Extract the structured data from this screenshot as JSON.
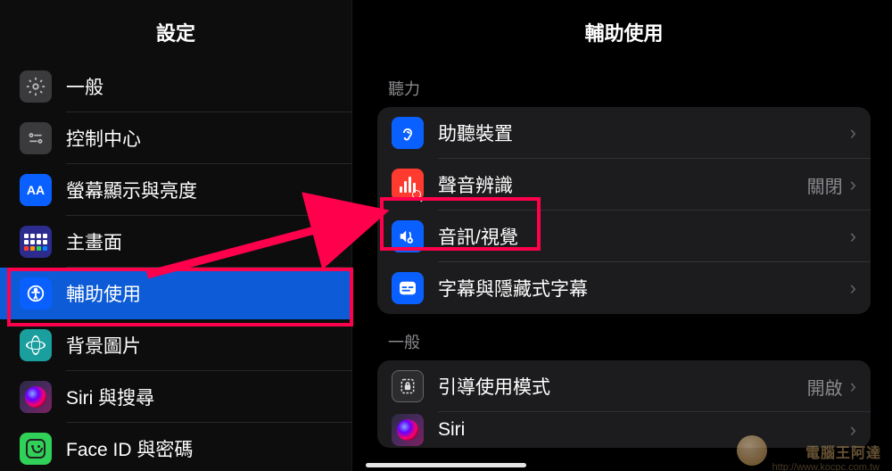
{
  "sidebar": {
    "title": "設定",
    "items": [
      {
        "label": "一般"
      },
      {
        "label": "控制中心"
      },
      {
        "label": "螢幕顯示與亮度"
      },
      {
        "label": "主畫面"
      },
      {
        "label": "輔助使用"
      },
      {
        "label": "背景圖片"
      },
      {
        "label": "Siri 與搜尋"
      },
      {
        "label": "Face ID 與密碼"
      }
    ]
  },
  "detail": {
    "title": "輔助使用",
    "sections": [
      {
        "header": "聽力",
        "rows": [
          {
            "label": "助聽裝置",
            "value": ""
          },
          {
            "label": "聲音辨識",
            "value": "關閉"
          },
          {
            "label": "音訊/視覺",
            "value": ""
          },
          {
            "label": "字幕與隱藏式字幕",
            "value": ""
          }
        ]
      },
      {
        "header": "一般",
        "rows": [
          {
            "label": "引導使用模式",
            "value": "開啟"
          },
          {
            "label": "Siri",
            "value": ""
          }
        ]
      }
    ]
  },
  "watermark": {
    "text": "電腦王阿達",
    "url": "http://www.kocpc.com.tw"
  },
  "annotations": {
    "sidebar_highlight_index": 4,
    "detail_highlight": {
      "section": 0,
      "row": 2
    },
    "arrow": true
  }
}
